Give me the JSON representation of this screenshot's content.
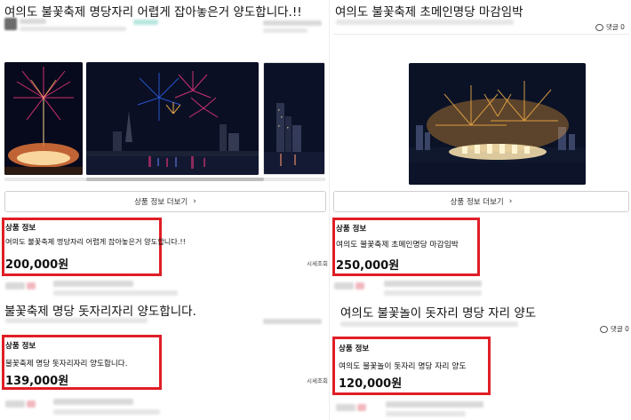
{
  "left": {
    "post1": {
      "title": "여의도 불꽃축제 명당자리 어렵게 잡아놓은거 양도합니다.!!",
      "more_button": "상품 정보 더보기",
      "info_heading": "상품 정보",
      "product_name": "여의도 불꽃축제 명당자리 어렵게 잡아놓은거 양도합니다.!!",
      "price": "200,000원",
      "detail_link": "시세조회"
    },
    "post2": {
      "title": "불꽃축제 명당 돗자리자리 양도합니다.",
      "info_heading": "상품 정보",
      "product_name": "불꽃축제 명당 돗자리자리 양도합니다.",
      "price": "139,000원",
      "detail_link": "시세조회"
    }
  },
  "right": {
    "post1": {
      "title": "여의도 불꽃축제 초메인명당 마감임박",
      "comment_label": "댓글 0",
      "more_button": "상품 정보 더보기",
      "info_heading": "상품 정보",
      "product_name": "여의도 불꽃축제 초메인명당 마감임박",
      "price": "250,000원"
    },
    "post2": {
      "title": "여의도 불꽃놀이 돗자리 명당 자리 양도",
      "comment_label": "댓글 0",
      "info_heading": "상품 정보",
      "product_name": "여의도 불꽃놀이 돗자리 명당 자리 양도",
      "price": "120,000원"
    }
  },
  "colors": {
    "highlight_border": "#e01e26",
    "night_sky": "#0a0f24",
    "firework_gold": "#f3b24a",
    "firework_magenta": "#e2357b"
  },
  "icons": [
    "chevron-right-icon",
    "comment-icon",
    "avatar-icon"
  ]
}
